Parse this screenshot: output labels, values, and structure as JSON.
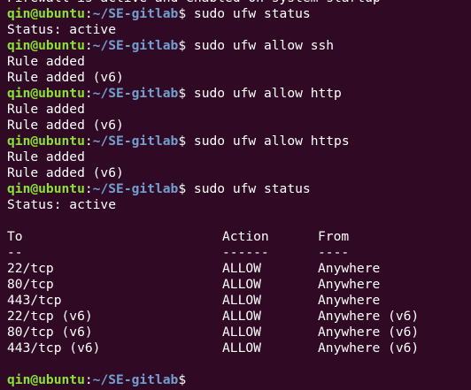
{
  "prompt": {
    "user_host": "qin@ubuntu",
    "sep": ":",
    "path": "~/SE-gitlab",
    "symbol": "$"
  },
  "lines": [
    {
      "type": "out",
      "text": "Firewall is active and enabled on system startup"
    },
    {
      "type": "cmd",
      "text": " sudo ufw status"
    },
    {
      "type": "out",
      "text": "Status: active"
    },
    {
      "type": "cmd",
      "text": " sudo ufw allow ssh"
    },
    {
      "type": "out",
      "text": "Rule added"
    },
    {
      "type": "out",
      "text": "Rule added (v6)"
    },
    {
      "type": "cmd",
      "text": " sudo ufw allow http"
    },
    {
      "type": "out",
      "text": "Rule added"
    },
    {
      "type": "out",
      "text": "Rule added (v6)"
    },
    {
      "type": "cmd",
      "text": " sudo ufw allow https"
    },
    {
      "type": "out",
      "text": "Rule added"
    },
    {
      "type": "out",
      "text": "Rule added (v6)"
    },
    {
      "type": "cmd",
      "text": " sudo ufw status"
    },
    {
      "type": "out",
      "text": "Status: active"
    },
    {
      "type": "blank",
      "text": ""
    },
    {
      "type": "row",
      "cols": [
        "To",
        "Action",
        "From"
      ]
    },
    {
      "type": "row",
      "cols": [
        "--",
        "------",
        "----"
      ]
    },
    {
      "type": "row",
      "cols": [
        "22/tcp",
        "ALLOW",
        "Anywhere"
      ]
    },
    {
      "type": "row",
      "cols": [
        "80/tcp",
        "ALLOW",
        "Anywhere"
      ]
    },
    {
      "type": "row",
      "cols": [
        "443/tcp",
        "ALLOW",
        "Anywhere"
      ]
    },
    {
      "type": "row",
      "cols": [
        "22/tcp (v6)",
        "ALLOW",
        "Anywhere (v6)"
      ]
    },
    {
      "type": "row",
      "cols": [
        "80/tcp (v6)",
        "ALLOW",
        "Anywhere (v6)"
      ]
    },
    {
      "type": "row",
      "cols": [
        "443/tcp (v6)",
        "ALLOW",
        "Anywhere (v6)"
      ]
    },
    {
      "type": "blank",
      "text": ""
    },
    {
      "type": "cmd",
      "text": ""
    }
  ],
  "colors": {
    "background": "#300a24",
    "user_host": "#8ae234",
    "path": "#729fcf",
    "text": "#ffffff"
  }
}
